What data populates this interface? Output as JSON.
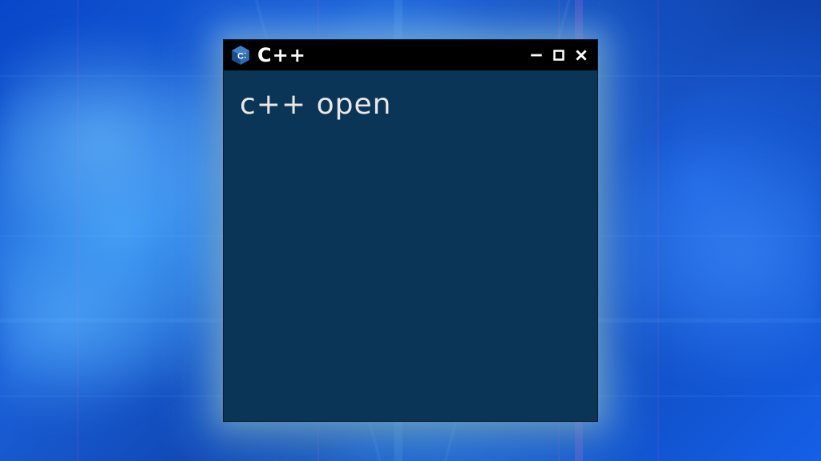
{
  "window": {
    "title": "C++",
    "icon_name": "cpp"
  },
  "body": {
    "text": "c++ open"
  },
  "colors": {
    "window_bg": "#0a3556",
    "titlebar_bg": "#000000",
    "text": "#e8e8e8",
    "glow": "#8cd2ff"
  }
}
